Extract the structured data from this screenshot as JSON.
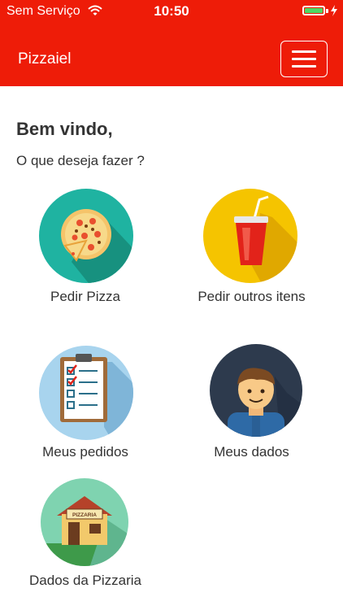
{
  "status": {
    "carrier": "Sem Serviço",
    "time": "10:50"
  },
  "header": {
    "title": "Pizzaiel"
  },
  "welcome": {
    "title": "Bem vindo,",
    "subtitle": "O que deseja fazer ?"
  },
  "menu": [
    {
      "label": "Pedir Pizza",
      "icon": "pizza-icon"
    },
    {
      "label": "Pedir outros itens",
      "icon": "soda-cup-icon"
    },
    {
      "label": "Meus pedidos",
      "icon": "clipboard-checklist-icon"
    },
    {
      "label": "Meus dados",
      "icon": "user-avatar-icon"
    },
    {
      "label": "Dados da Pizzaria",
      "icon": "pizzeria-house-icon",
      "sign": "PIZZARIA"
    }
  ],
  "colors": {
    "brand": "#ee1c08"
  }
}
